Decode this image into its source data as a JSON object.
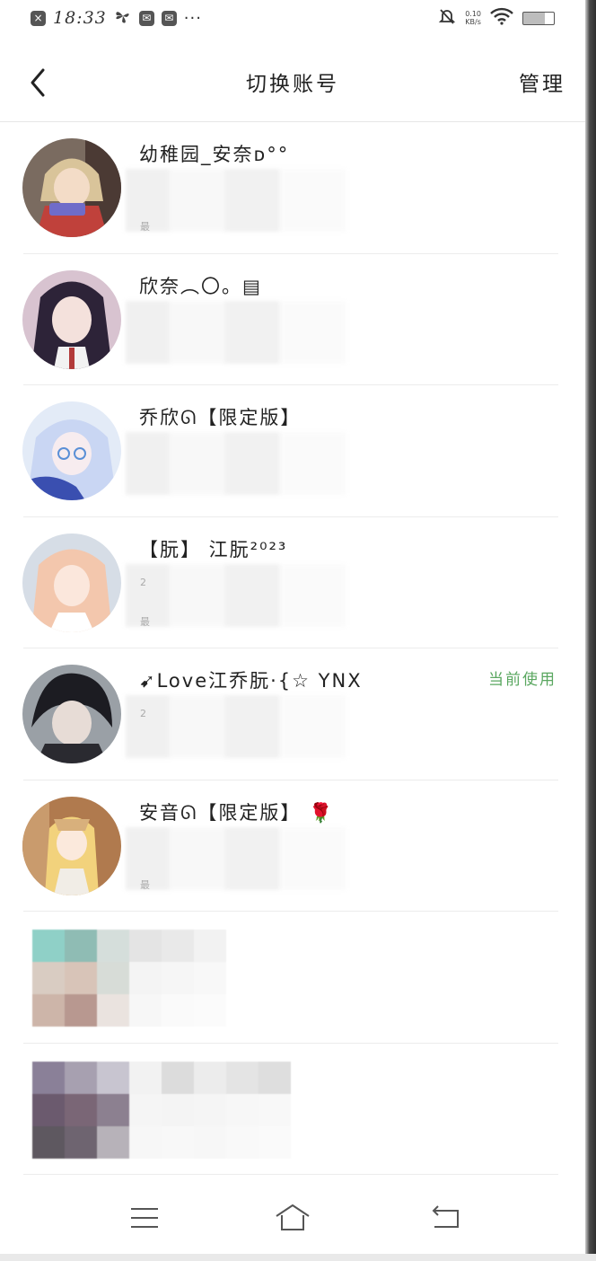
{
  "status_bar": {
    "time": "18:33",
    "dots": "···",
    "speed_top": "0.10",
    "speed_bottom": "KB/s",
    "battery": "7"
  },
  "header": {
    "title": "切换账号",
    "manage_label": "管理"
  },
  "accounts": [
    {
      "name": "幼稚园_安奈ᴅ°°",
      "sub1": "",
      "sub2": "最",
      "current": ""
    },
    {
      "name": "欣奈︵〇。▤",
      "sub1": "",
      "sub2": "",
      "current": ""
    },
    {
      "name": "乔欣ᘏ【限定版】",
      "sub1": "",
      "sub2": "",
      "current": ""
    },
    {
      "name": "【朊】 江朊²⁰²³",
      "sub1": "2",
      "sub2": "最",
      "current": ""
    },
    {
      "name": "➹Love江乔朊·{☆ YNX",
      "sub1": "2",
      "sub2": "",
      "current": "当前使用"
    },
    {
      "name": "安音ᘏ【限定版】 🌹",
      "sub1": "",
      "sub2": "最",
      "current": ""
    }
  ],
  "colors": {
    "accent_green": "#5aa760",
    "divider": "#ececec"
  },
  "icons": {
    "back": "chevron-left-icon",
    "menu": "menu-icon",
    "home": "home-icon",
    "return": "return-icon"
  }
}
